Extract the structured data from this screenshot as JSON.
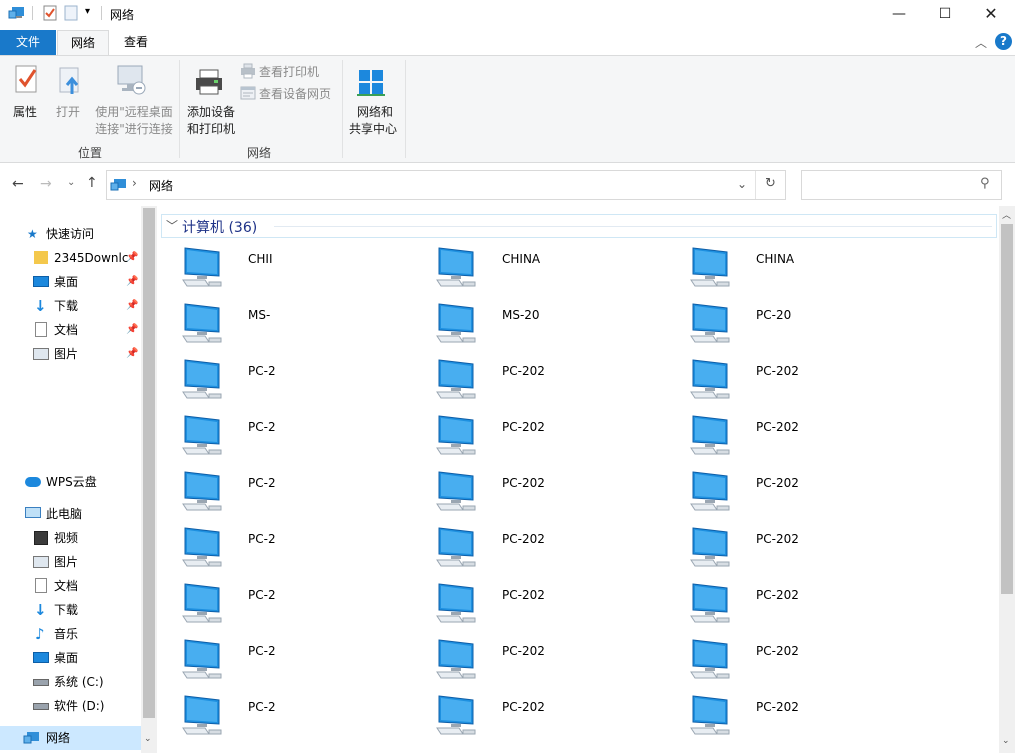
{
  "window": {
    "title": "网络"
  },
  "ribbon_tabs": {
    "file": "文件",
    "network": "网络",
    "view": "查看"
  },
  "ribbon": {
    "properties": "属性",
    "open": "打开",
    "rdp_line1": "使用\"远程桌面",
    "rdp_line2": "连接\"进行连接",
    "group_location": "位置",
    "add_device_line1": "添加设备",
    "add_device_line2": "和打印机",
    "view_printers": "查看打印机",
    "view_device_page": "查看设备网页",
    "group_network": "网络",
    "net_center_line1": "网络和",
    "net_center_line2": "共享中心"
  },
  "address": {
    "path": "网络",
    "separator": "›"
  },
  "search": {
    "placeholder": ""
  },
  "sidebar": {
    "quick_access": "快速访问",
    "quick_items": [
      {
        "label": "2345Downlc",
        "icon": "folder-icon",
        "pinned": true
      },
      {
        "label": "桌面",
        "icon": "desktop-icon",
        "pinned": true
      },
      {
        "label": "下载",
        "icon": "download-icon",
        "pinned": true
      },
      {
        "label": "文档",
        "icon": "document-icon",
        "pinned": true
      },
      {
        "label": "图片",
        "icon": "picture-icon",
        "pinned": true
      }
    ],
    "wps_cloud": "WPS云盘",
    "this_pc": "此电脑",
    "pc_items": [
      {
        "label": "视频",
        "icon": "video-icon"
      },
      {
        "label": "图片",
        "icon": "picture-icon"
      },
      {
        "label": "文档",
        "icon": "document-icon"
      },
      {
        "label": "下载",
        "icon": "download-icon"
      },
      {
        "label": "音乐",
        "icon": "music-icon"
      },
      {
        "label": "桌面",
        "icon": "desktop-icon"
      },
      {
        "label": "系统 (C:)",
        "icon": "drive-icon"
      },
      {
        "label": "软件 (D:)",
        "icon": "drive-icon"
      }
    ],
    "network": "网络"
  },
  "content": {
    "group_title": "计算机 (36)",
    "computers": [
      [
        "CHII",
        "CHINA",
        "CHINA"
      ],
      [
        "MS-",
        "MS-20",
        "PC-20"
      ],
      [
        "PC-2",
        "PC-202",
        "PC-202"
      ],
      [
        "PC-2",
        "PC-202",
        "PC-202"
      ],
      [
        "PC-2",
        "PC-202",
        "PC-202"
      ],
      [
        "PC-2",
        "PC-202",
        "PC-202"
      ],
      [
        "PC-2",
        "PC-202",
        "PC-202"
      ],
      [
        "PC-2",
        "PC-202",
        "PC-202"
      ],
      [
        "PC-2",
        "PC-202",
        "PC-202"
      ]
    ]
  },
  "colors": {
    "accent": "#1979ca",
    "group_title": "#1e3287",
    "monitor": "#1e90e0"
  }
}
